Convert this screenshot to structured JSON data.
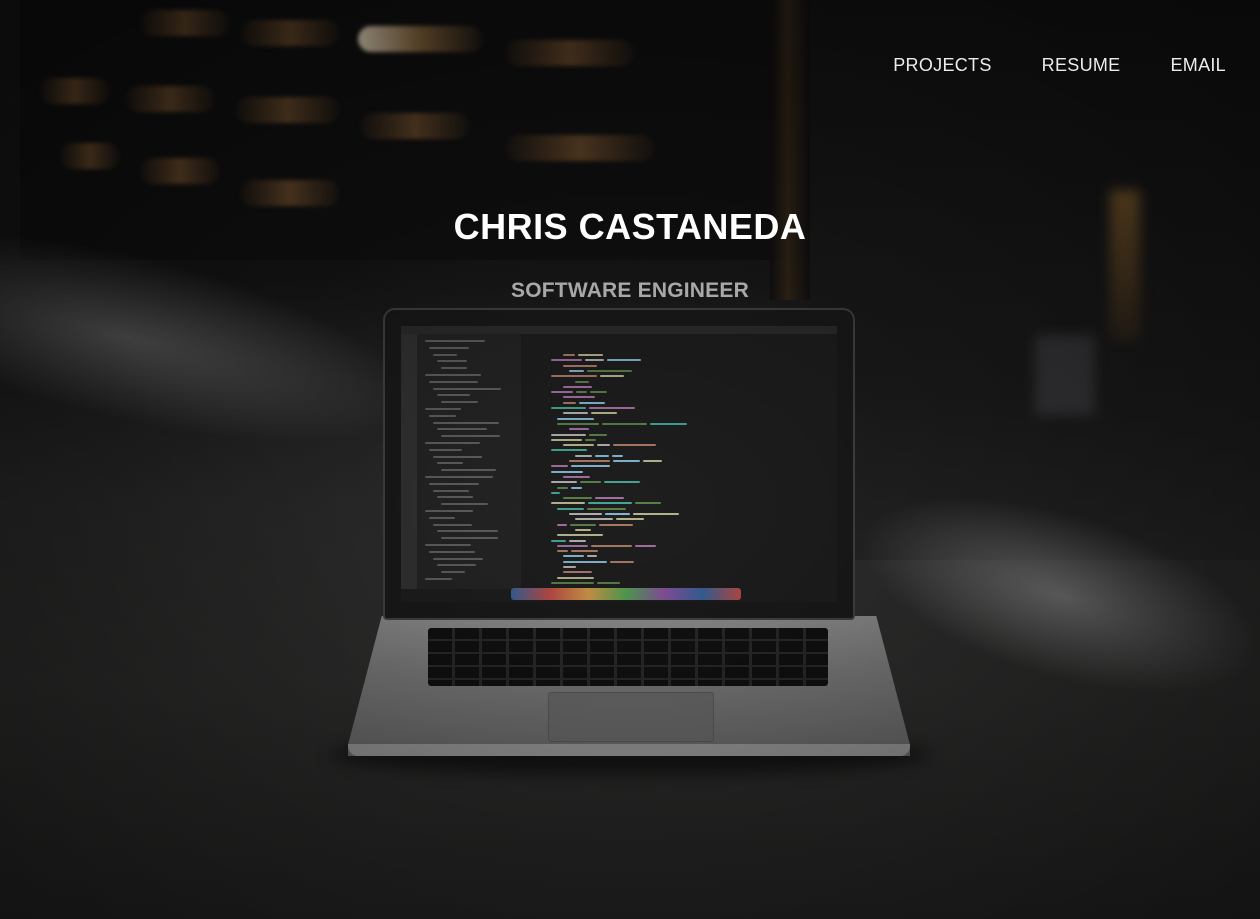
{
  "nav": {
    "items": [
      {
        "label": "PROJECTS"
      },
      {
        "label": "RESUME"
      },
      {
        "label": "EMAIL"
      }
    ]
  },
  "hero": {
    "name": "CHRIS CASTANEDA",
    "role": "SOFTWARE ENGINEER",
    "background_image": "laptop-with-code-editor-photo"
  },
  "colors": {
    "background": "#1b1b1b",
    "title_text": "#ffffff",
    "subtitle_text": "#a8a8a8",
    "nav_text": "#ececec"
  }
}
